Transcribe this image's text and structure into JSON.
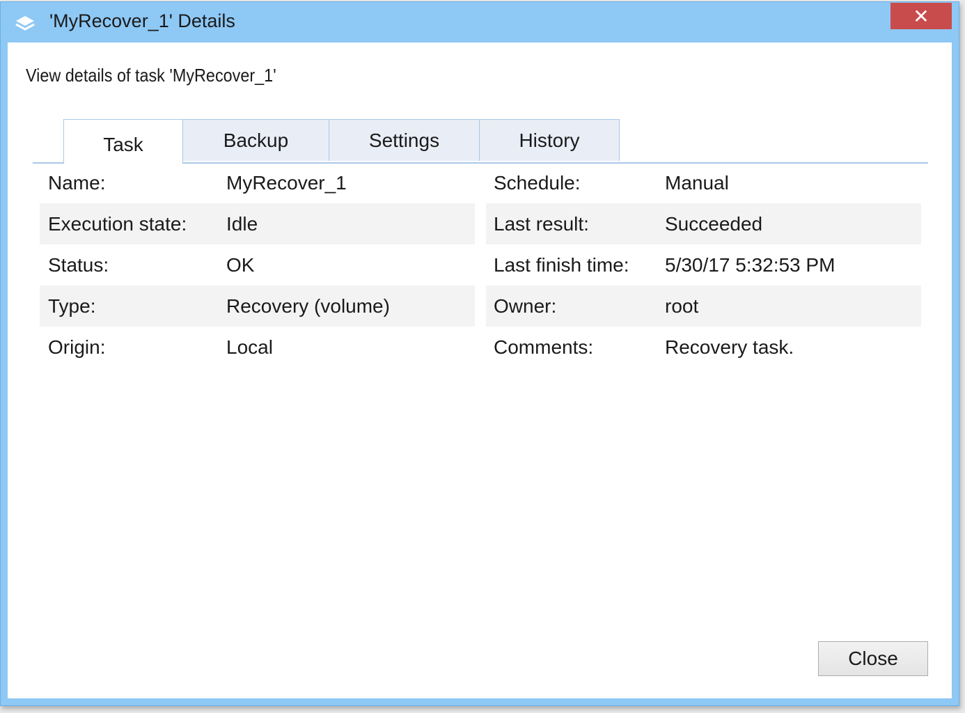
{
  "window": {
    "title": "'MyRecover_1' Details",
    "close_glyph": "✕"
  },
  "heading": "View details of task 'MyRecover_1'",
  "tabs": [
    {
      "label": "Task",
      "active": true
    },
    {
      "label": "Backup",
      "active": false
    },
    {
      "label": "Settings",
      "active": false
    },
    {
      "label": "History",
      "active": false
    }
  ],
  "details": {
    "rows": [
      {
        "left_label": "Name:",
        "left_value": "MyRecover_1",
        "right_label": "Schedule:",
        "right_value": "Manual"
      },
      {
        "left_label": "Execution state:",
        "left_value": "Idle",
        "right_label": "Last result:",
        "right_value": "Succeeded"
      },
      {
        "left_label": "Status:",
        "left_value": "OK",
        "right_label": "Last finish time:",
        "right_value": "5/30/17 5:32:53 PM"
      },
      {
        "left_label": "Type:",
        "left_value": "Recovery (volume)",
        "right_label": "Owner:",
        "right_value": "root"
      },
      {
        "left_label": "Origin:",
        "left_value": "Local",
        "right_label": "Comments:",
        "right_value": "Recovery task."
      }
    ]
  },
  "buttons": {
    "close_label": "Close"
  },
  "icons": {
    "title_icon": "layers-icon"
  },
  "colors": {
    "titlebar": "#8ec8f5",
    "close_button": "#c94c4c",
    "tab_border": "#a9c8e8",
    "row_stripe": "#f3f3f3"
  }
}
